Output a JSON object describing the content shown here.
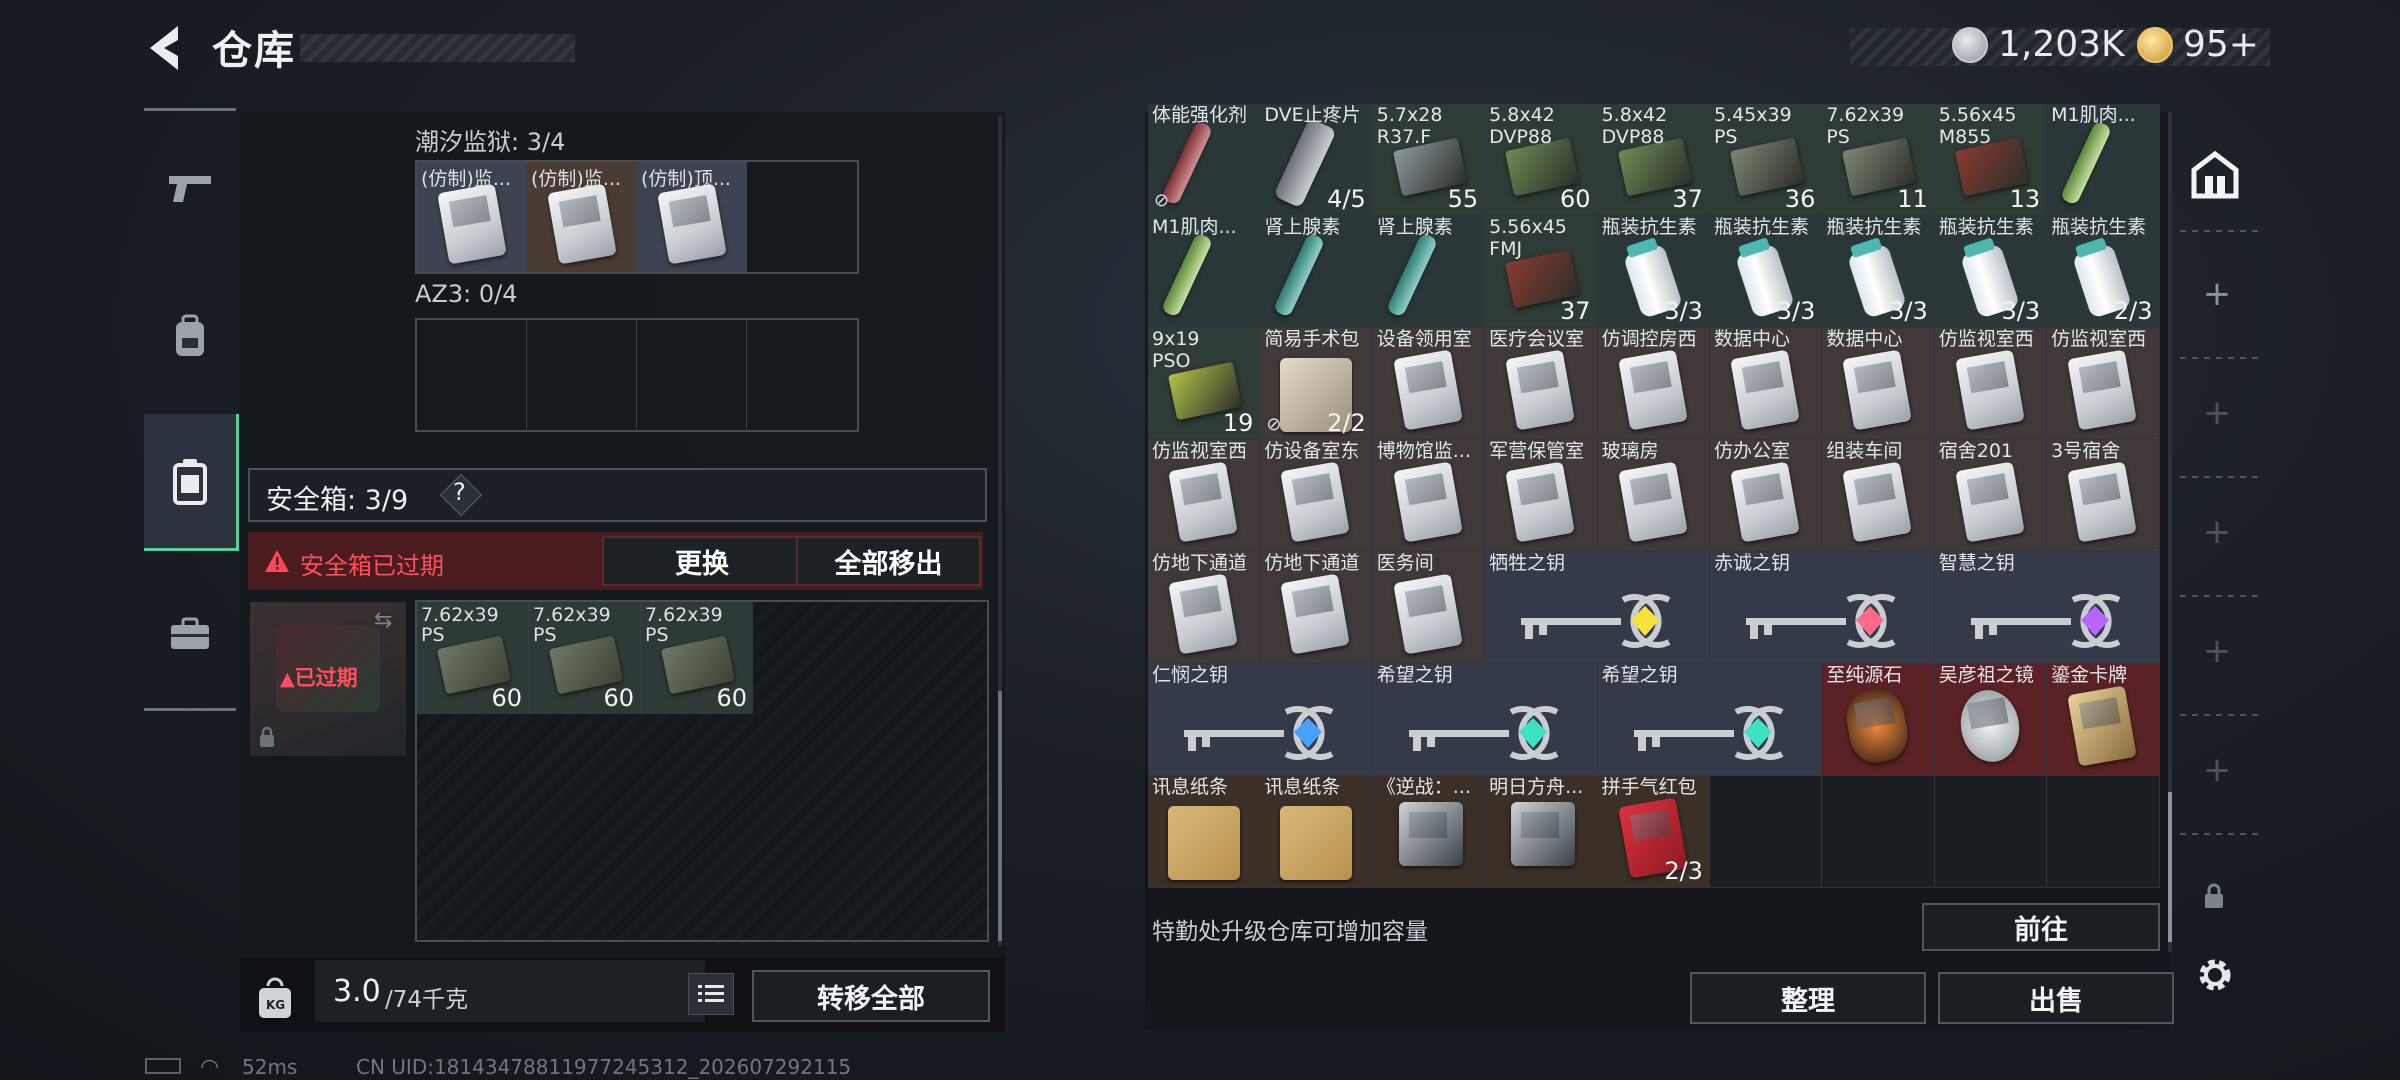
{
  "header": {
    "title": "仓库",
    "currency_primary": "1,203K",
    "currency_secondary": "95+"
  },
  "left": {
    "section1_label": "潮汐监狱: 3/4",
    "section1_items": [
      "(仿制)监...",
      "(仿制)监...",
      "(仿制)顶..."
    ],
    "section2_label": "AZ3: 0/4",
    "safebox_label": "安全箱: 3/9",
    "help": "?",
    "expired_text": "安全箱已过期",
    "replace_button": "更换",
    "remove_all_button": "全部移出",
    "expired_badge": "已过期",
    "safebox_items": [
      {
        "name": "7.62x39",
        "sub": "PS",
        "count": "60"
      },
      {
        "name": "7.62x39",
        "sub": "PS",
        "count": "60"
      },
      {
        "name": "7.62x39",
        "sub": "PS",
        "count": "60"
      }
    ],
    "weight_value": "3.0",
    "weight_max": "/74千克",
    "transfer_all_button": "转移全部",
    "weight_unit_badge": "KG"
  },
  "inventory": {
    "rows": [
      [
        {
          "name": "体能强化剂",
          "count": "",
          "lock": "⊘"
        },
        {
          "name": "DVE止疼片",
          "count": "4/5"
        },
        {
          "name": "5.7x28",
          "sub": "R37.F",
          "count": "55"
        },
        {
          "name": "5.8x42",
          "sub": "DVP88",
          "count": "60"
        },
        {
          "name": "5.8x42",
          "sub": "DVP88",
          "count": "37"
        },
        {
          "name": "5.45x39",
          "sub": "PS",
          "count": "36"
        },
        {
          "name": "7.62x39",
          "sub": "PS",
          "count": "11"
        },
        {
          "name": "5.56x45",
          "sub": "M855",
          "count": "13"
        },
        {
          "name": "M1肌肉...",
          "count": ""
        }
      ],
      [
        {
          "name": "M1肌肉...",
          "count": ""
        },
        {
          "name": "肾上腺素",
          "count": ""
        },
        {
          "name": "肾上腺素",
          "count": ""
        },
        {
          "name": "5.56x45",
          "sub": "FMJ",
          "count": "37"
        },
        {
          "name": "瓶装抗生素",
          "count": "3/3"
        },
        {
          "name": "瓶装抗生素",
          "count": "3/3"
        },
        {
          "name": "瓶装抗生素",
          "count": "3/3"
        },
        {
          "name": "瓶装抗生素",
          "count": "3/3"
        },
        {
          "name": "瓶装抗生素",
          "count": "2/3"
        }
      ],
      [
        {
          "name": "9x19",
          "sub": "PSO",
          "count": "19"
        },
        {
          "name": "简易手术包",
          "count": "2/2",
          "lock": "⊘"
        },
        {
          "name": "设备领用室",
          "count": ""
        },
        {
          "name": "医疗会议室",
          "count": ""
        },
        {
          "name": "仿调控房西",
          "count": ""
        },
        {
          "name": "数据中心",
          "count": ""
        },
        {
          "name": "数据中心",
          "count": ""
        },
        {
          "name": "仿监视室西",
          "count": ""
        },
        {
          "name": "仿监视室西",
          "count": ""
        }
      ],
      [
        {
          "name": "仿监视室西",
          "count": ""
        },
        {
          "name": "仿设备室东",
          "count": ""
        },
        {
          "name": "博物馆监...",
          "count": ""
        },
        {
          "name": "军营保管室",
          "count": ""
        },
        {
          "name": "玻璃房",
          "count": ""
        },
        {
          "name": "仿办公室",
          "count": ""
        },
        {
          "name": "组装车间",
          "count": ""
        },
        {
          "name": "宿舍201",
          "count": ""
        },
        {
          "name": "3号宿舍",
          "count": ""
        }
      ],
      [
        {
          "name": "仿地下通道",
          "count": ""
        },
        {
          "name": "仿地下通道",
          "count": ""
        },
        {
          "name": "医务间",
          "count": ""
        },
        {
          "name": "牺牲之钥",
          "count": "",
          "span": 2,
          "gem": "#f5e23a"
        },
        {
          "name": "赤诚之钥",
          "count": "",
          "span": 2,
          "gem": "#ff6a88"
        },
        {
          "name": "智慧之钥",
          "count": "",
          "span": 2,
          "gem": "#b665ff"
        }
      ],
      [
        {
          "name": "仁悯之钥",
          "count": "",
          "span": 2,
          "gem": "#4aa0ff"
        },
        {
          "name": "希望之钥",
          "count": "",
          "span": 2,
          "gem": "#3de2c4"
        },
        {
          "name": "希望之钥",
          "count": "",
          "span": 2,
          "gem": "#3de2c4"
        },
        {
          "name": "至纯源石",
          "count": ""
        },
        {
          "name": "吴彦祖之镜",
          "count": ""
        },
        {
          "name": "鎏金卡牌",
          "count": ""
        }
      ],
      [
        {
          "name": "讯息纸条",
          "count": ""
        },
        {
          "name": "讯息纸条",
          "count": ""
        },
        {
          "name": "《逆战：...",
          "count": ""
        },
        {
          "name": "明日方舟...",
          "count": ""
        },
        {
          "name": "拼手气红包",
          "count": "2/3"
        },
        {
          "name": "",
          "count": ""
        },
        {
          "name": "",
          "count": ""
        },
        {
          "name": "",
          "count": ""
        },
        {
          "name": "",
          "count": ""
        }
      ]
    ],
    "upgrade_hint": "特勤处升级仓库可增加容量",
    "goto_button": "前往",
    "sort_button": "整理",
    "sell_button": "出售"
  },
  "status": {
    "ping": "52ms",
    "uid": "CN UID:18143478811977245312_202607292115"
  },
  "colors": {
    "accent_green": "#4fd39b",
    "expired_red": "#e0313f",
    "rare_red_bg": "#5a2226",
    "gold_bg": "#4a3a24"
  }
}
